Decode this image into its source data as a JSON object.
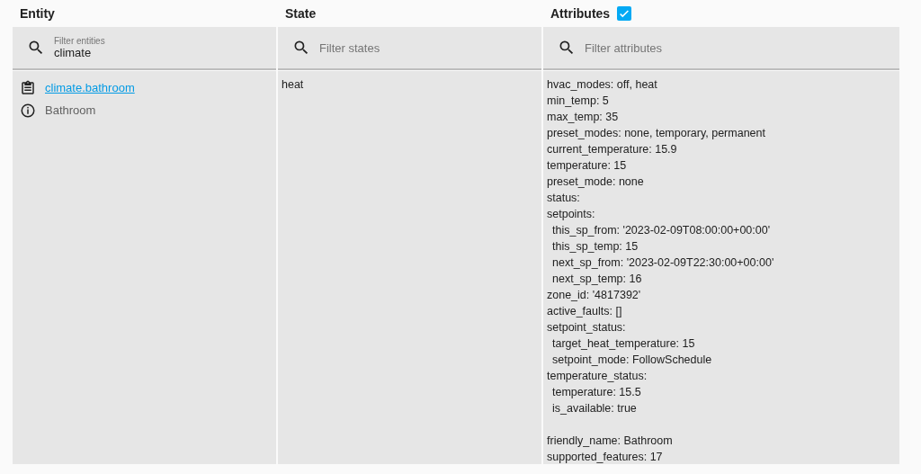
{
  "columns": [
    {
      "title": "Entity"
    },
    {
      "title": "State"
    },
    {
      "title": "Attributes",
      "checkbox": {
        "checked": true
      }
    }
  ],
  "filters": [
    {
      "label": "Filter entities",
      "value": "climate"
    },
    {
      "placeholder": "Filter states"
    },
    {
      "placeholder": "Filter attributes"
    }
  ],
  "row": {
    "entity_id": "climate.bathroom",
    "friendly_name": "Bathroom",
    "state": "heat",
    "attributes": [
      {
        "text": "hvac_modes: off, heat"
      },
      {
        "text": "min_temp: 5"
      },
      {
        "text": "max_temp: 35"
      },
      {
        "text": "preset_modes: none, temporary, permanent"
      },
      {
        "text": "current_temperature: 15.9"
      },
      {
        "text": "temperature: 15"
      },
      {
        "text": "preset_mode: none"
      },
      {
        "text": "status:"
      },
      {
        "text": "setpoints:",
        "children": [
          {
            "text": "this_sp_from: '2023-02-09T08:00:00+00:00'"
          },
          {
            "text": "this_sp_temp: 15"
          },
          {
            "text": "next_sp_from: '2023-02-09T22:30:00+00:00'"
          },
          {
            "text": "next_sp_temp: 16"
          }
        ]
      },
      {
        "text": "zone_id: '4817392'"
      },
      {
        "text": "active_faults: []"
      },
      {
        "text": "setpoint_status:",
        "children": [
          {
            "text": "target_heat_temperature: 15"
          },
          {
            "text": "setpoint_mode: FollowSchedule"
          }
        ]
      },
      {
        "text": "temperature_status:",
        "children": [
          {
            "text": "temperature: 15.5"
          },
          {
            "text": "is_available: true"
          }
        ]
      },
      {
        "text": "friendly_name: Bathroom",
        "spaced": true
      },
      {
        "text": "supported_features: 17"
      }
    ]
  }
}
